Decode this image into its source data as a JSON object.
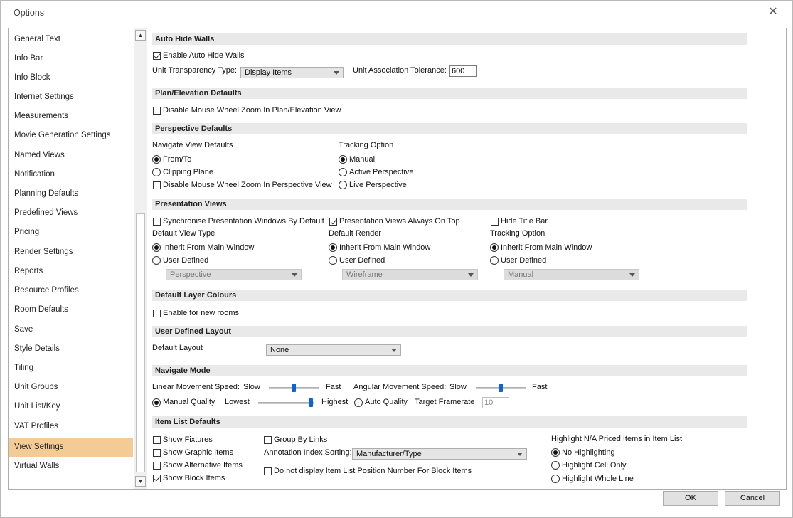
{
  "window": {
    "title": "Options"
  },
  "nav": {
    "items": [
      "General Text",
      "Info Bar",
      "Info Block",
      "Internet Settings",
      "Measurements",
      "Movie Generation Settings",
      "Named Views",
      "Notification",
      "Planning Defaults",
      "Predefined Views",
      "Pricing",
      "Render Settings",
      "Reports",
      "Resource Profiles",
      "Room Defaults",
      "Save",
      "Style Details",
      "Tiling",
      "Unit Groups",
      "Unit List/Key",
      "VAT Profiles",
      "View Settings",
      "Virtual Walls"
    ],
    "selected": "View Settings"
  },
  "auto_hide": {
    "header": "Auto Hide Walls",
    "enable_label": "Enable Auto Hide Walls",
    "transparency_label": "Unit Transparency Type:",
    "transparency_value": "Display Items",
    "tolerance_label": "Unit Association Tolerance:",
    "tolerance_value": "600"
  },
  "plan": {
    "header": "Plan/Elevation Defaults",
    "disable_label": "Disable Mouse Wheel Zoom In Plan/Elevation View"
  },
  "perspective": {
    "header": "Perspective Defaults",
    "nav_label": "Navigate View Defaults",
    "from_to": "From/To",
    "clipping": "Clipping Plane",
    "disable_label": "Disable Mouse Wheel Zoom In Perspective View",
    "tracking_label": "Tracking Option",
    "manual": "Manual",
    "active": "Active Perspective",
    "live": "Live Perspective"
  },
  "presentation": {
    "header": "Presentation Views",
    "sync_label": "Synchronise Presentation Windows By Default",
    "always_top_label": "Presentation Views Always On Top",
    "hide_title_label": "Hide Title Bar",
    "view_type_label": "Default View Type",
    "render_label": "Default Render",
    "tracking_label": "Tracking Option",
    "inherit": "Inherit From Main Window",
    "user_defined": "User Defined",
    "view_type_value": "Perspective",
    "render_value": "Wireframe",
    "tracking_value": "Manual"
  },
  "layer": {
    "header": "Default Layer Colours",
    "enable_label": "Enable for new rooms"
  },
  "layout": {
    "header": "User Defined Layout",
    "default_label": "Default Layout",
    "default_value": "None"
  },
  "navigate": {
    "header": "Navigate Mode",
    "linear_label": "Linear Movement Speed:",
    "angular_label": "Angular Movement Speed:",
    "slow": "Slow",
    "fast": "Fast",
    "manual_quality": "Manual Quality",
    "lowest": "Lowest",
    "highest": "Highest",
    "auto_quality": "Auto Quality",
    "framerate_label": "Target Framerate",
    "framerate_value": "10",
    "linear_speed_fraction": 0.5,
    "angular_speed_fraction": 0.5,
    "quality_fraction": 0.95
  },
  "item_list": {
    "header": "Item List Defaults",
    "fixtures": "Show Fixtures",
    "graphic": "Show Graphic Items",
    "alternative": "Show Alternative Items",
    "block": "Show Block Items",
    "group_links": "Group By Links",
    "annotation_label": "Annotation Index Sorting:",
    "annotation_value": "Manufacturer/Type",
    "no_position": "Do not display Item List Position Number For Block Items",
    "highlight_label": "Highlight N/A Priced Items in Item List",
    "no_highlight": "No Highlighting",
    "cell_only": "Highlight Cell Only",
    "whole_line": "Highlight Whole Line"
  },
  "buttons": {
    "ok": "OK",
    "cancel": "Cancel"
  }
}
